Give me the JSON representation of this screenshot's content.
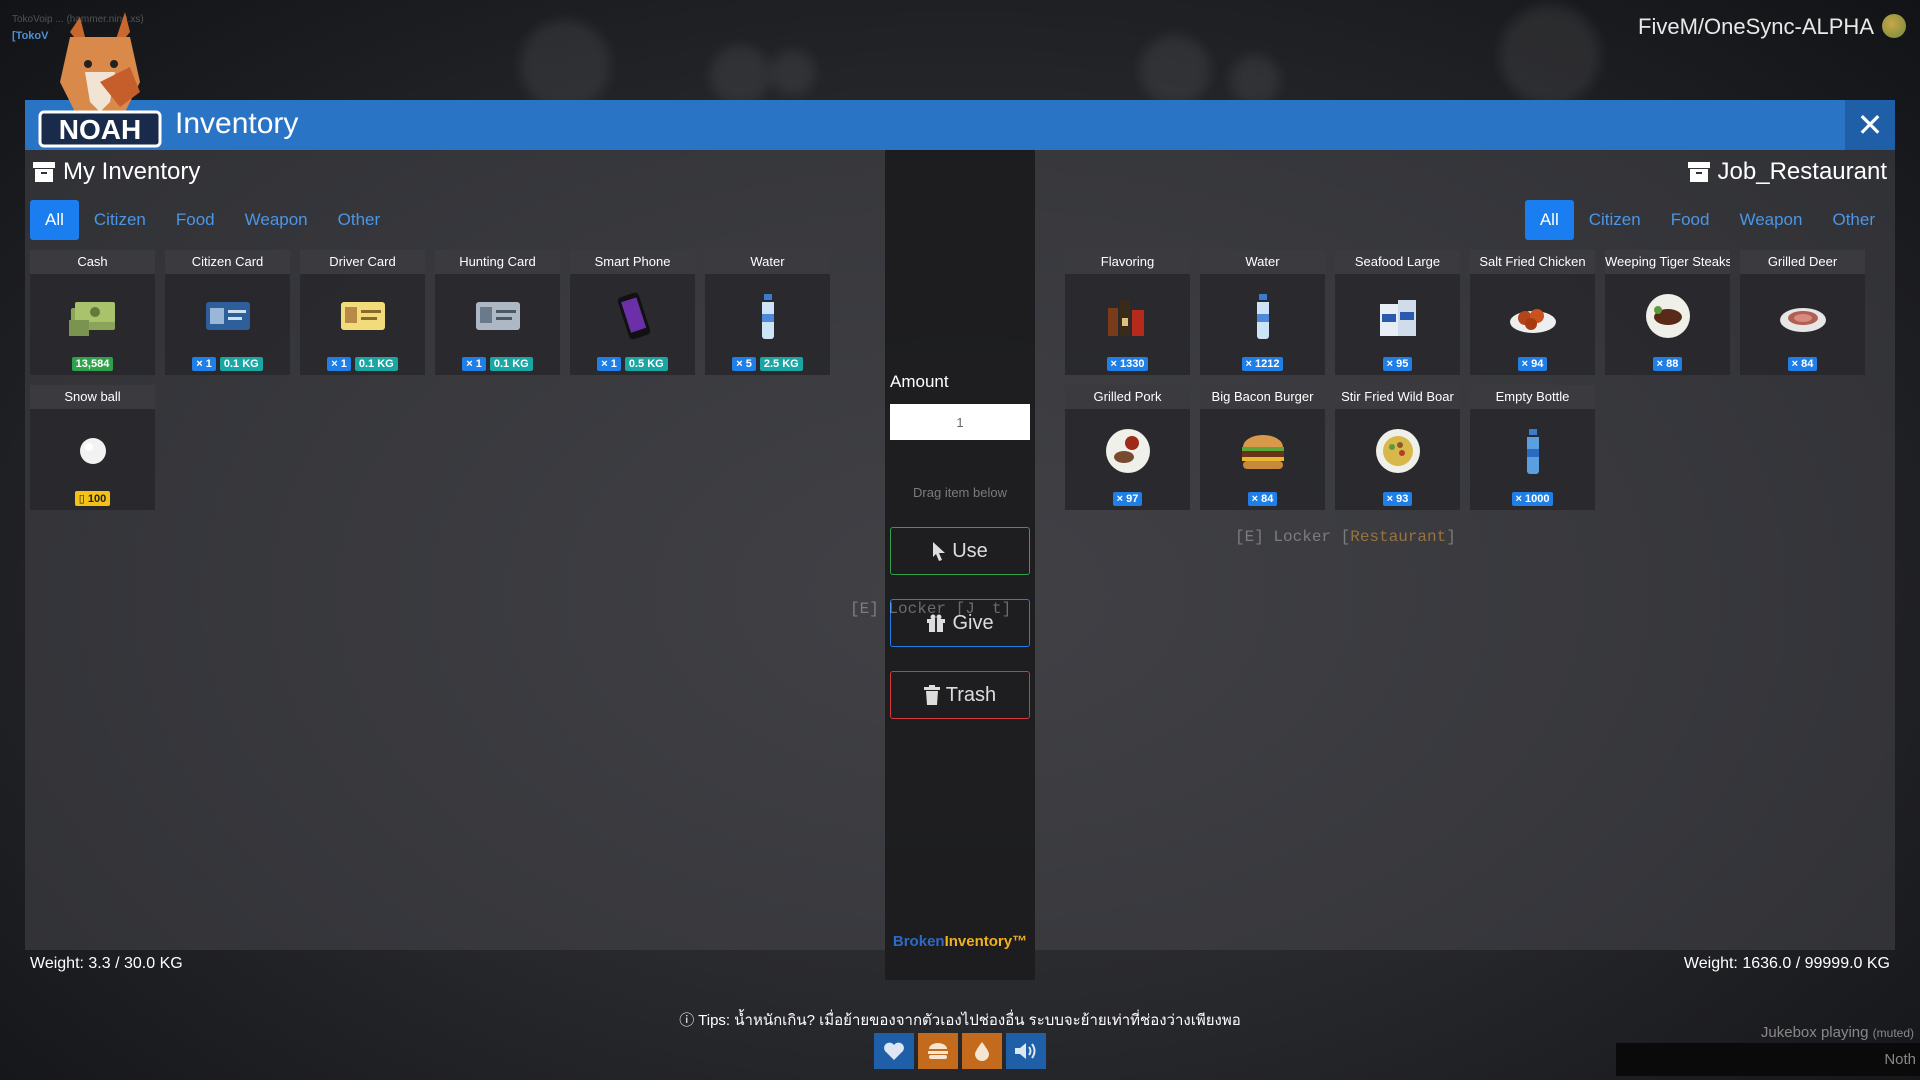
{
  "hud_top": {
    "small_text": "TokoVoip ... (hammer.ning.xs)",
    "tag": "[TokoV",
    "server_name": "FiveM/OneSync-ALPHA"
  },
  "window": {
    "title": "Inventory",
    "close_label": "✕",
    "logo_text": "NOAH"
  },
  "left": {
    "title": "My Inventory",
    "tabs": [
      "All",
      "Citizen",
      "Food",
      "Weapon",
      "Other"
    ],
    "items": [
      {
        "name": "Cash",
        "icon": "cash-stack-icon",
        "badges": [
          {
            "t": "13,584",
            "c": "green"
          }
        ]
      },
      {
        "name": "Citizen Card",
        "icon": "id-card-icon",
        "badges": [
          {
            "t": "× 1",
            "c": "blue"
          },
          {
            "t": "0.1 KG",
            "c": "teal"
          }
        ]
      },
      {
        "name": "Driver Card",
        "icon": "license-card-icon",
        "badges": [
          {
            "t": "× 1",
            "c": "blue"
          },
          {
            "t": "0.1 KG",
            "c": "teal"
          }
        ]
      },
      {
        "name": "Hunting Card",
        "icon": "hunting-card-icon",
        "badges": [
          {
            "t": "× 1",
            "c": "blue"
          },
          {
            "t": "0.1 KG",
            "c": "teal"
          }
        ]
      },
      {
        "name": "Smart Phone",
        "icon": "phone-icon",
        "badges": [
          {
            "t": "× 1",
            "c": "blue"
          },
          {
            "t": "0.5 KG",
            "c": "teal"
          }
        ]
      },
      {
        "name": "Water",
        "icon": "water-bottle-icon",
        "badges": [
          {
            "t": "× 5",
            "c": "blue"
          },
          {
            "t": "2.5 KG",
            "c": "teal"
          }
        ]
      },
      {
        "name": "Snow ball",
        "icon": "snowball-icon",
        "badges": [
          {
            "t": "▯ 100",
            "c": "yellow"
          }
        ]
      }
    ],
    "weight": "Weight: 3.3 / 30.0 KG"
  },
  "middle": {
    "amount_label": "Amount",
    "amount_value": "1",
    "drag_hint": "Drag item below",
    "use_label": "Use",
    "give_label": "Give",
    "trash_label": "Trash",
    "brand_a": "Broken",
    "brand_b": "Inventory™"
  },
  "right": {
    "title": "Job_Restaurant",
    "tabs": [
      "All",
      "Citizen",
      "Food",
      "Weapon",
      "Other"
    ],
    "items": [
      {
        "name": "Flavoring",
        "icon": "sauce-bottles-icon",
        "badges": [
          {
            "t": "× 1330",
            "c": "blue"
          }
        ]
      },
      {
        "name": "Water",
        "icon": "water-bottle-icon",
        "badges": [
          {
            "t": "× 1212",
            "c": "blue"
          }
        ]
      },
      {
        "name": "Seafood Large",
        "icon": "seafood-box-icon",
        "badges": [
          {
            "t": "× 95",
            "c": "blue"
          }
        ]
      },
      {
        "name": "Salt Fried Chicken",
        "icon": "fried-chicken-icon",
        "badges": [
          {
            "t": "× 94",
            "c": "blue"
          }
        ]
      },
      {
        "name": "Weeping Tiger Steaks",
        "icon": "steak-plate-icon",
        "badges": [
          {
            "t": "× 88",
            "c": "blue"
          }
        ]
      },
      {
        "name": "Grilled Deer",
        "icon": "grilled-meat-icon",
        "badges": [
          {
            "t": "× 84",
            "c": "blue"
          }
        ]
      },
      {
        "name": "Grilled Pork",
        "icon": "grilled-pork-icon",
        "badges": [
          {
            "t": "× 97",
            "c": "blue"
          }
        ]
      },
      {
        "name": "Big Bacon Burger",
        "icon": "burger-icon",
        "badges": [
          {
            "t": "× 84",
            "c": "blue"
          }
        ]
      },
      {
        "name": "Stir Fried Wild Boar",
        "icon": "stir-fry-icon",
        "badges": [
          {
            "t": "× 93",
            "c": "blue"
          }
        ]
      },
      {
        "name": "Empty Bottle",
        "icon": "empty-bottle-icon",
        "badges": [
          {
            "t": "× 1000",
            "c": "blue"
          }
        ]
      }
    ],
    "weight": "Weight: 1636.0 / 99999.0 KG"
  },
  "world": {
    "locker_prefix": "[E] Locker [",
    "locker_name": "Restaurant",
    "locker_suffix": "]",
    "locker_ghost_left": "[E] Locker [J",
    "locker_ghost_right": "t]"
  },
  "footer": {
    "tips": "Tips: น้ำหนักเกิน? เมื่อย้ายของจากตัวเองไปช่องอื่น ระบบจะย้ายเท่าที่ช่องว่างเพียงพอ",
    "hud_icons": [
      "heart-icon",
      "burger-icon",
      "water-drop-icon",
      "speaker-icon"
    ],
    "jukebox": "Jukebox playing",
    "jukebox_muted": "(muted)",
    "notification": "Noth"
  },
  "colors": {
    "accent_blue": "#2a74c6",
    "tab_active": "#1a7ef0",
    "use_green": "#2fa14a",
    "give_blue": "#1f7fe6",
    "trash_red": "#d43a3a"
  }
}
